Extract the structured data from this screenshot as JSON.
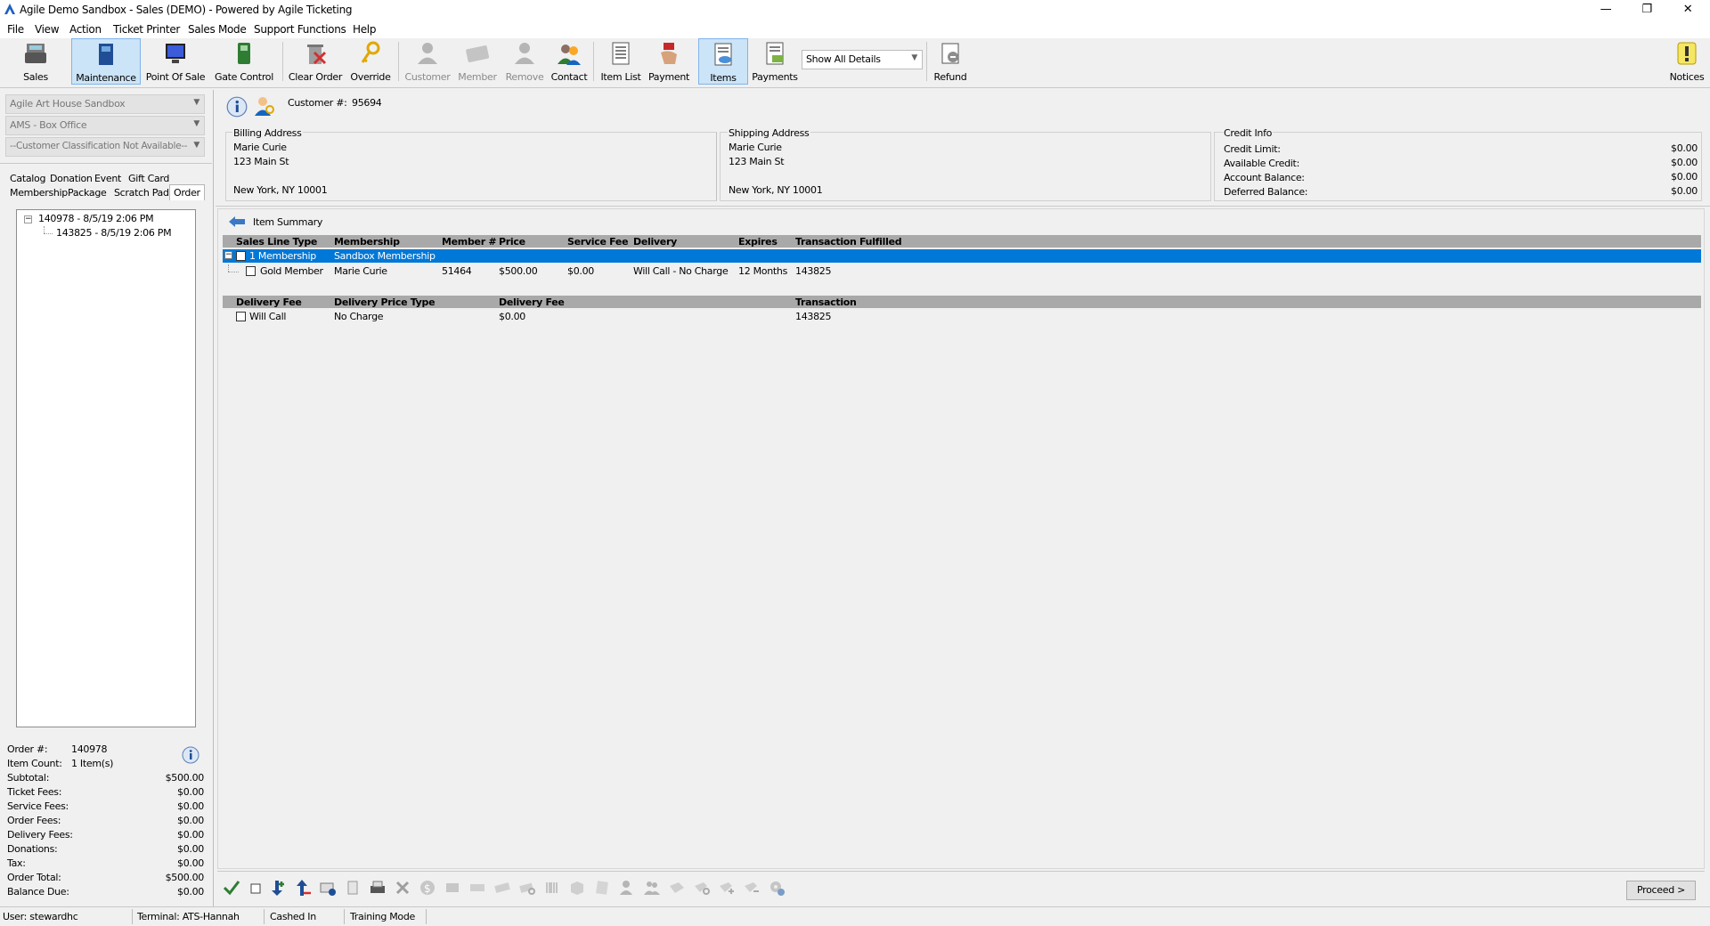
{
  "window": {
    "title": "Agile Demo Sandbox - Sales (DEMO) - Powered by Agile Ticketing",
    "controls": {
      "minimize": "—",
      "restore": "❐",
      "close": "✕"
    }
  },
  "menu": [
    "File",
    "View",
    "Action",
    "Ticket Printer",
    "Sales Mode",
    "Support Functions",
    "Help"
  ],
  "toolbar": {
    "sales": "Sales",
    "maintenance": "Maintenance",
    "point_of_sale": "Point Of Sale",
    "gate_control": "Gate Control",
    "clear_order": "Clear Order",
    "override": "Override",
    "customer": "Customer",
    "member": "Member",
    "remove": "Remove",
    "contact": "Contact",
    "item_list": "Item List",
    "payment": "Payment",
    "items": "Items",
    "payments": "Payments",
    "detail_filter": "Show All Details",
    "refund": "Refund",
    "notices": "Notices"
  },
  "left": {
    "org": "Agile Art House Sandbox",
    "box_office": "AMS - Box Office",
    "classification": "--Customer Classification Not Available--",
    "tabs_row1": [
      "Catalog",
      "Donation",
      "Event",
      "Gift Card"
    ],
    "tabs_row2": [
      "Membership",
      "Package",
      "Scratch Pad",
      "Order"
    ],
    "tree": {
      "parent": "140978 - 8/5/19 2:06 PM",
      "child": "143825 - 8/5/19 2:06 PM",
      "expander": "−"
    },
    "summary": {
      "order_no_label": "Order #:",
      "order_no": "140978",
      "item_count_label": "Item Count:",
      "item_count": "1 Item(s)",
      "rows": [
        {
          "label": "Subtotal:",
          "value": "$500.00"
        },
        {
          "label": "Ticket Fees:",
          "value": "$0.00"
        },
        {
          "label": "Service Fees:",
          "value": "$0.00"
        },
        {
          "label": "Order Fees:",
          "value": "$0.00"
        },
        {
          "label": "Delivery Fees:",
          "value": "$0.00"
        },
        {
          "label": "Donations:",
          "value": "$0.00"
        },
        {
          "label": "Tax:",
          "value": "$0.00"
        },
        {
          "label": "Order Total:",
          "value": "$500.00"
        },
        {
          "label": "Balance Due:",
          "value": "$0.00"
        }
      ]
    }
  },
  "customer": {
    "number_label": "Customer #:",
    "number": "95694",
    "billing": {
      "title": "Billing Address",
      "name": "Marie Curie",
      "street": "123 Main St",
      "city": "New York, NY 10001"
    },
    "shipping": {
      "title": "Shipping Address",
      "name": "Marie Curie",
      "street": "123 Main St",
      "city": "New York, NY 10001"
    },
    "credit": {
      "title": "Credit Info",
      "rows": [
        {
          "label": "Credit Limit:",
          "value": "$0.00"
        },
        {
          "label": "Available Credit:",
          "value": "$0.00"
        },
        {
          "label": "Account Balance:",
          "value": "$0.00"
        },
        {
          "label": "Deferred Balance:",
          "value": "$0.00"
        }
      ]
    }
  },
  "items": {
    "title": "Item Summary",
    "headers": [
      "Sales Line Type",
      "Membership",
      "Member #",
      "Price",
      "Service Fee",
      "Delivery",
      "Expires",
      "Transaction",
      "Fulfilled"
    ],
    "group_row": {
      "expander": "−",
      "type": "1 Membership",
      "membership": "Sandbox Membership"
    },
    "detail_row": {
      "type": "Gold Member",
      "membership": "Marie Curie",
      "member_no": "51464",
      "price": "$500.00",
      "service_fee": "$0.00",
      "delivery": "Will Call - No Charge",
      "expires": "12 Months",
      "transaction": "143825"
    },
    "delivery_headers": [
      "Delivery Fee",
      "Delivery Price Type",
      "Delivery Fee",
      "Transaction"
    ],
    "delivery_row": {
      "fee": "Will Call",
      "price_type": "No Charge",
      "amount": "$0.00",
      "transaction": "143825"
    }
  },
  "proceed": "Proceed >",
  "status": {
    "user": "User:  stewardhc",
    "terminal": "Terminal:  ATS-Hannah",
    "cash": "Cashed In",
    "mode": "Training Mode"
  }
}
